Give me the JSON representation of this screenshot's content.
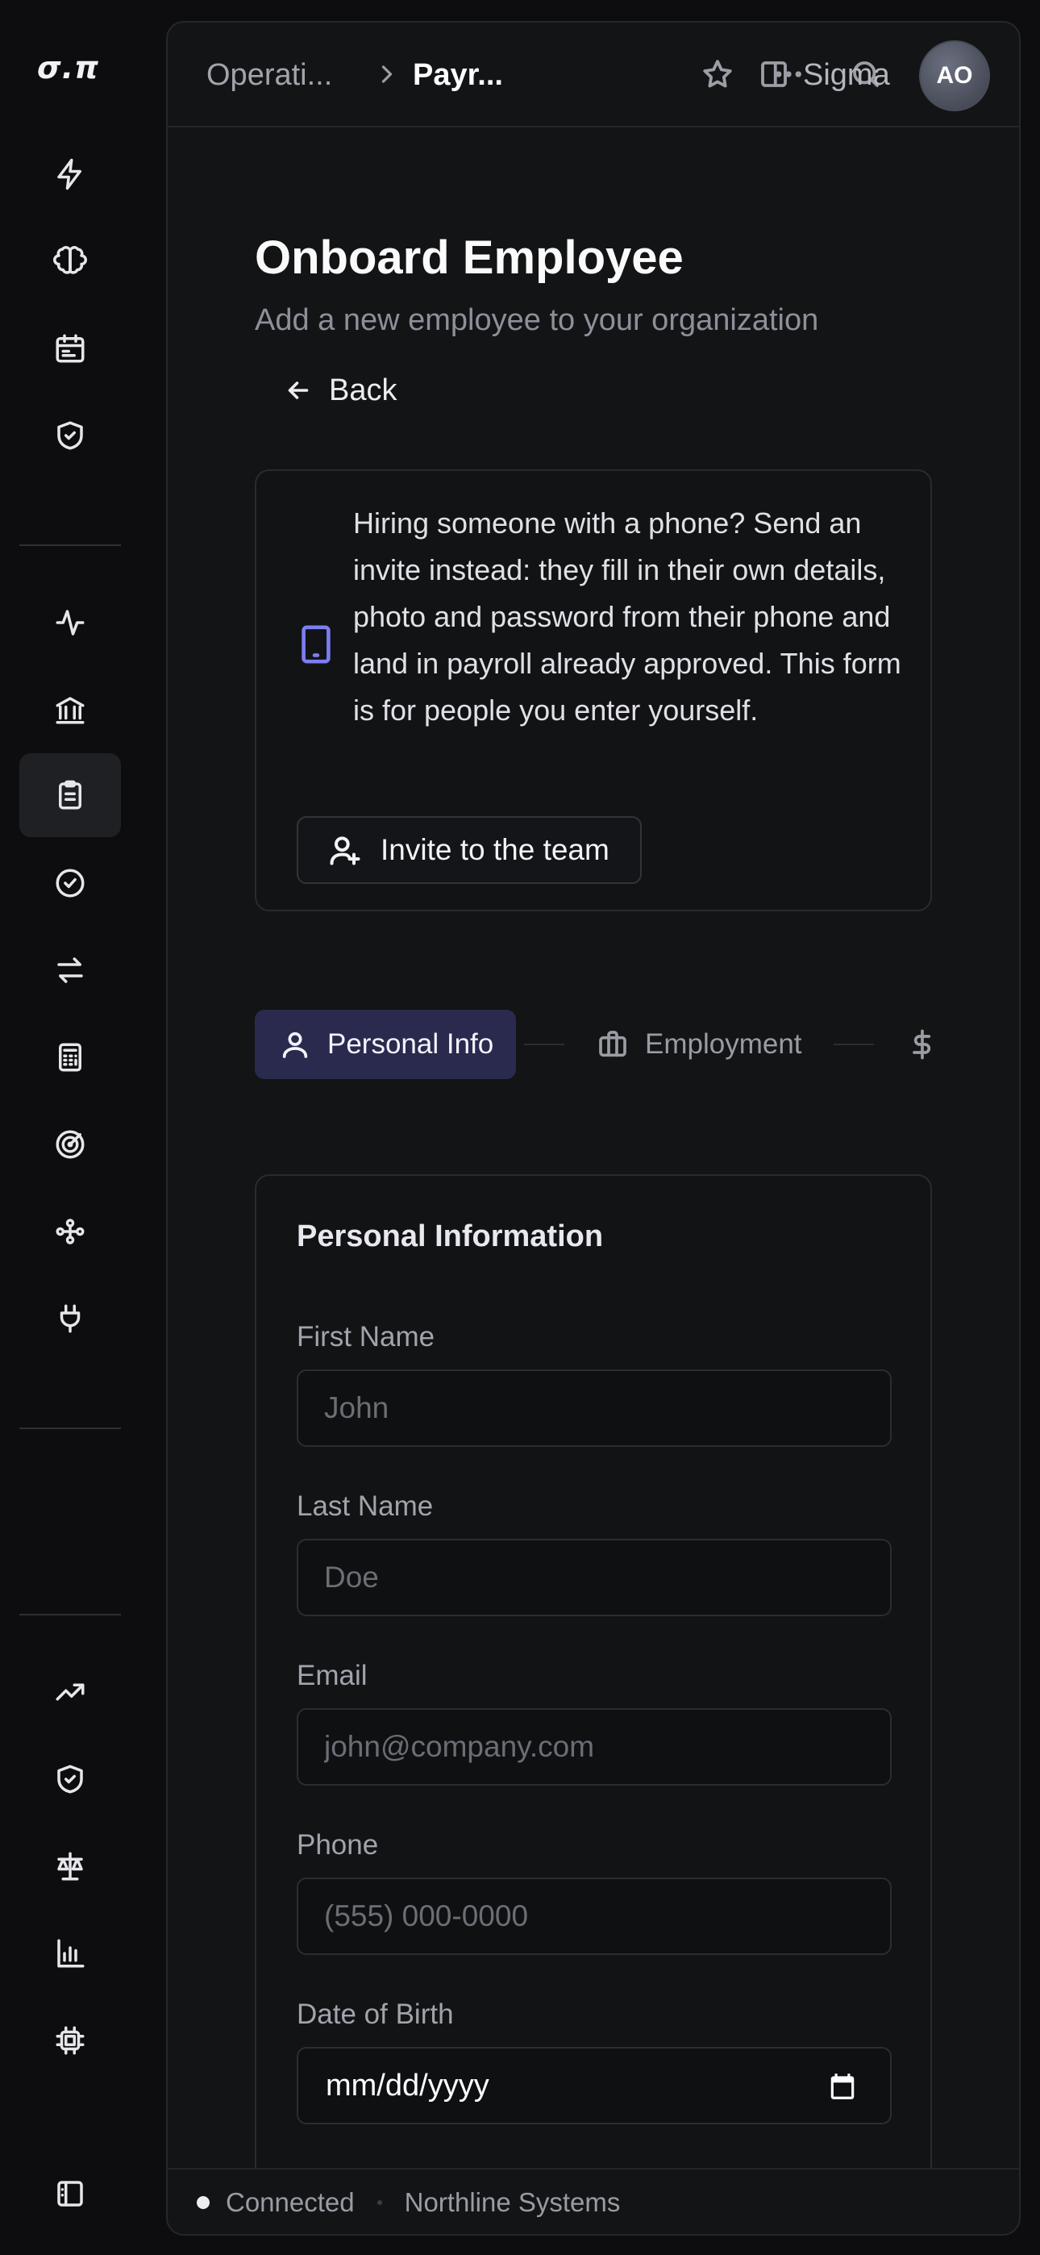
{
  "app": {
    "logo": "σ.π"
  },
  "rail": {
    "top_icons": [
      "bolt-icon",
      "brain-icon",
      "calendar-icon",
      "shield-check-icon"
    ],
    "mid_icons": [
      "activity-icon",
      "bank-icon",
      "clipboard-icon",
      "badge-check-icon",
      "arrows-swap-icon",
      "calculator-icon",
      "target-icon",
      "workflow-icon",
      "plug-icon"
    ],
    "bottom_icons": [
      "trending-up-icon",
      "shield-check-icon",
      "scale-icon",
      "bar-chart-icon",
      "cpu-icon"
    ],
    "active_item": "clipboard-icon",
    "footer_icon": "panel-icon"
  },
  "topbar": {
    "breadcrumb_parent": "Operati...",
    "breadcrumb_current": "Payr...",
    "workspace_label": "Sigma",
    "avatar_initials": "AO"
  },
  "page": {
    "title": "Onboard Employee",
    "subtitle": "Add a new employee to your organization",
    "back_label": "Back"
  },
  "invite": {
    "text": "Hiring someone with a phone? Send an invite instead: they fill in their own details, photo and password from their phone and land in payroll already approved. This form is for people you enter yourself.",
    "button_label": "Invite to the team",
    "accent": "#7c7ef2"
  },
  "steps": [
    {
      "label": "Personal Info",
      "icon": "user-icon",
      "active": true
    },
    {
      "label": "Employment",
      "icon": "briefcase-icon",
      "active": false
    },
    {
      "label": "",
      "icon": "dollar-icon",
      "active": false
    }
  ],
  "form": {
    "title": "Personal Information",
    "first_name": {
      "label": "First Name",
      "placeholder": "John",
      "value": ""
    },
    "last_name": {
      "label": "Last Name",
      "placeholder": "Doe",
      "value": ""
    },
    "email": {
      "label": "Email",
      "placeholder": "john@company.com",
      "value": ""
    },
    "phone": {
      "label": "Phone",
      "placeholder": "(555) 000-0000",
      "value": ""
    },
    "dob": {
      "label": "Date of Birth",
      "placeholder": "mm/dd/yyyy"
    }
  },
  "status": {
    "connection": "Connected",
    "organization": "Northline Systems"
  },
  "colors": {
    "background": "#0d0d10",
    "panel": "#131416",
    "active_step": "#2a2a4e"
  }
}
